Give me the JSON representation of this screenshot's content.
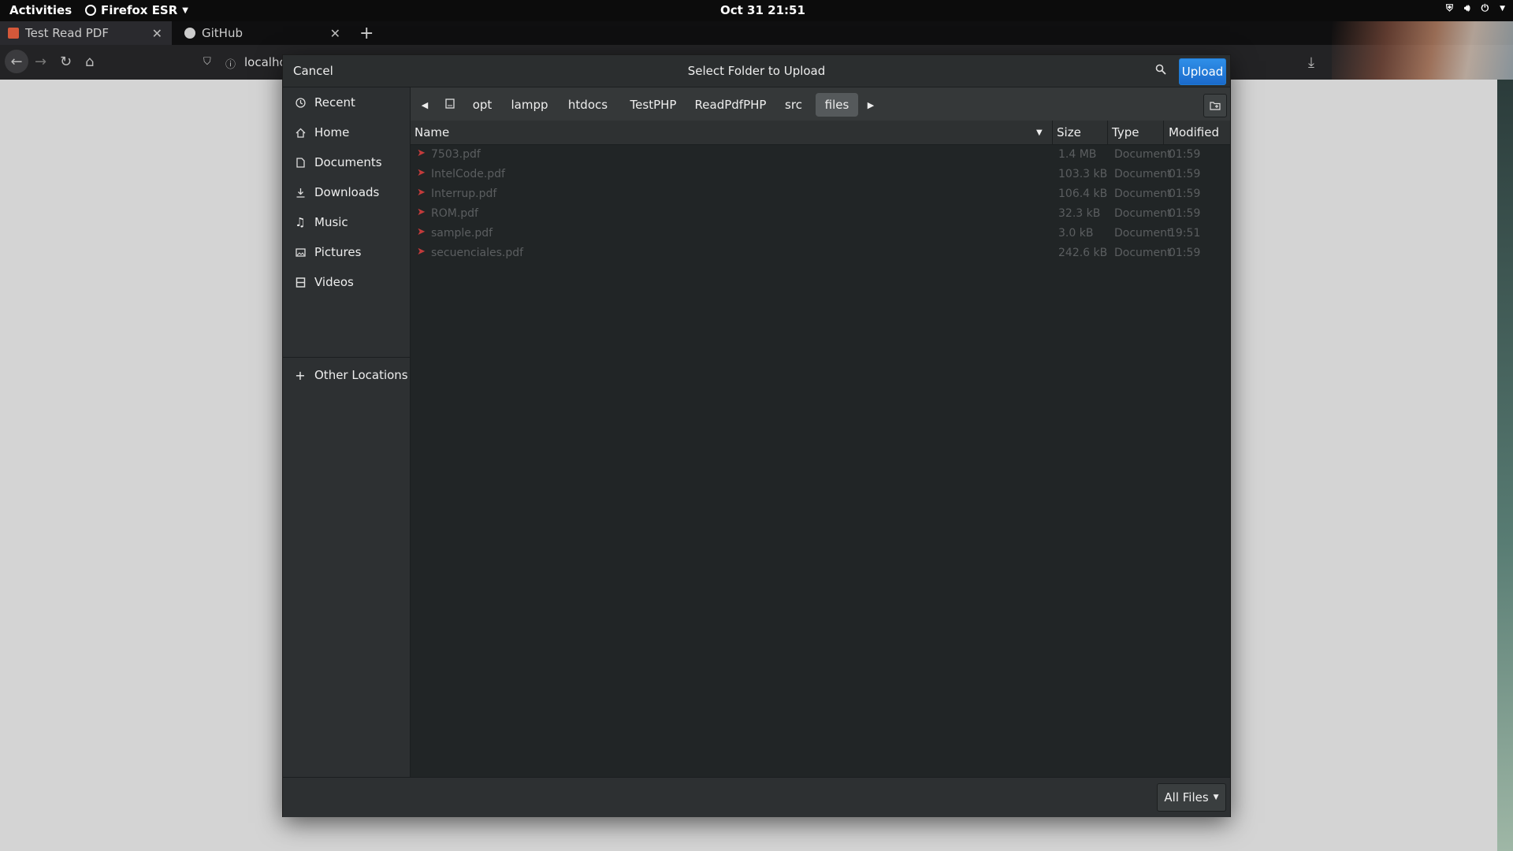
{
  "topbar": {
    "activities": "Activities",
    "app_menu": "Firefox ESR",
    "clock": "Oct 31  21:51"
  },
  "browser": {
    "tabs": [
      {
        "label": "Test Read PDF",
        "icon": "pdf-favicon"
      },
      {
        "label": "GitHub",
        "icon": "github-icon"
      }
    ],
    "url_partial": "localho"
  },
  "dialog": {
    "cancel_label": "Cancel",
    "title": "Select Folder to Upload",
    "upload_label": "Upload",
    "sidebar": [
      {
        "label": "Recent",
        "icon": "clock-icon"
      },
      {
        "label": "Home",
        "icon": "home-icon"
      },
      {
        "label": "Documents",
        "icon": "documents-icon"
      },
      {
        "label": "Downloads",
        "icon": "download-icon"
      },
      {
        "label": "Music",
        "icon": "music-icon"
      },
      {
        "label": "Pictures",
        "icon": "pictures-icon"
      },
      {
        "label": "Videos",
        "icon": "videos-icon"
      },
      {
        "label": "Other Locations",
        "icon": "plus-icon"
      }
    ],
    "path": [
      "opt",
      "lampp",
      "htdocs",
      "TestPHP",
      "ReadPdfPHP",
      "src",
      "files"
    ],
    "active_crumb": "files",
    "columns": {
      "name": "Name",
      "size": "Size",
      "type": "Type",
      "modified": "Modified"
    },
    "files": [
      {
        "name": "7503.pdf",
        "size": "1.4 MB",
        "type": "Document",
        "modified": "01:59"
      },
      {
        "name": "IntelCode.pdf",
        "size": "103.3 kB",
        "type": "Document",
        "modified": "01:59"
      },
      {
        "name": "Interrup.pdf",
        "size": "106.4 kB",
        "type": "Document",
        "modified": "01:59"
      },
      {
        "name": "ROM.pdf",
        "size": "32.3 kB",
        "type": "Document",
        "modified": "01:59"
      },
      {
        "name": "sample.pdf",
        "size": "3.0 kB",
        "type": "Document",
        "modified": "19:51"
      },
      {
        "name": "secuenciales.pdf",
        "size": "242.6 kB",
        "type": "Document",
        "modified": "01:59"
      }
    ],
    "filter_label": "All Files",
    "colors": {
      "accent": "#2f8fe8",
      "pdf_icon": "#c23b3b"
    }
  }
}
